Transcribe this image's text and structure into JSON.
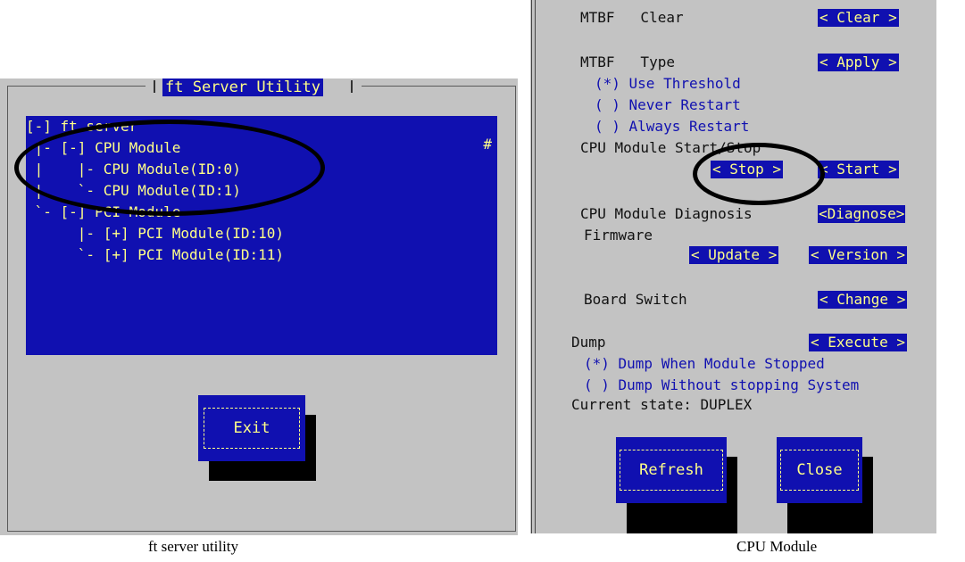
{
  "left_panel": {
    "title": "ft Server Utility",
    "tree": [
      "[-] ft server",
      " |- [-] CPU Module",
      " |    |- CPU Module(ID:0)",
      " |    `- CPU Module(ID:1)",
      " `- [-] PCI Module",
      "      |- [+] PCI Module(ID:10)",
      "      `- [+] PCI Module(ID:11)"
    ],
    "scroll_marker": "#",
    "exit_label": "Exit",
    "caption": "ft server utility"
  },
  "right_panel": {
    "mtbf_clear_label": "MTBF   Clear",
    "mtbf_clear_button": "< Clear >",
    "mtbf_type_label": "MTBF   Type",
    "mtbf_type_button": "< Apply >",
    "options": [
      "(*) Use Threshold",
      "( ) Never Restart",
      "( ) Always Restart"
    ],
    "start_stop_label": "CPU Module Start/Stop",
    "stop_button": "< Stop >",
    "start_button": "< Start >",
    "diagnosis_label": "CPU Module Diagnosis",
    "diagnose_button": "<Diagnose>",
    "firmware_label": "Firmware",
    "update_button": "< Update >",
    "version_button": "< Version >",
    "board_switch_label": "Board Switch",
    "change_button": "< Change >",
    "dump_label": "Dump",
    "execute_button": "< Execute >",
    "dump_options": [
      "(*) Dump When Module Stopped",
      "( ) Dump Without stopping System"
    ],
    "current_state": "Current state: DUPLEX",
    "refresh_label": "Refresh",
    "close_label": "Close",
    "caption": "CPU Module"
  },
  "colors": {
    "background": "#c3c3c3",
    "panel_blue": "#1010b0",
    "highlight_text": "#ffff88",
    "option_text": "#1010b0"
  }
}
